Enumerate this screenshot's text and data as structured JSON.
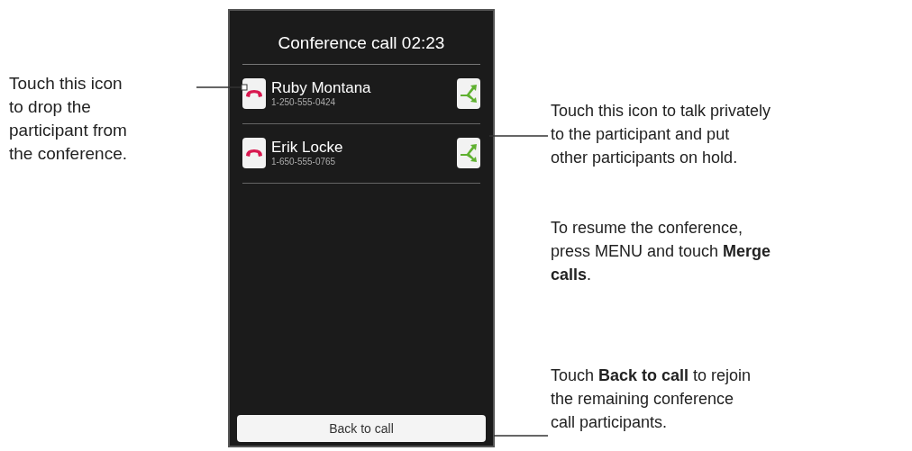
{
  "phone_screen": {
    "title": "Conference call 02:23",
    "participants": [
      {
        "name": "Ruby Montana",
        "number": "1-250-555-0424"
      },
      {
        "name": "Erik Locke",
        "number": "1-650-555-0765"
      }
    ],
    "back_button": "Back to call"
  },
  "left_callout": "Touch this icon\nto drop the\nparticipant from\nthe conference.",
  "right_callouts": [
    "Touch this icon to talk privately\nto the participant and put\nother participants on hold.",
    "To resume the conference,\npress MENU and touch **Merge\ncalls**.",
    "Touch **Back to call** to rejoin\nthe remaining conference\ncall participants."
  ]
}
